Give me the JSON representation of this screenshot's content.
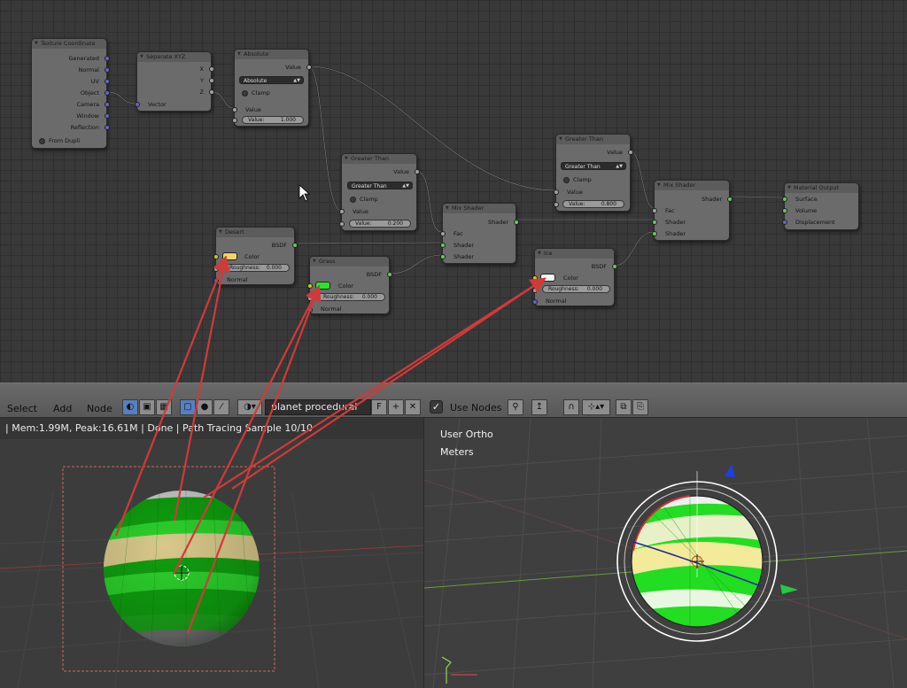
{
  "colors": {
    "socket_shader": "#63c763",
    "socket_vector": "#6363c7",
    "socket_value": "#a1a1a1",
    "socket_color": "#c7c729",
    "arrow": "#d03a3a",
    "desert_color": "#f0d56b",
    "grass_color": "#2ee02e",
    "ice_color": "#f5f5f5",
    "toggle_active": "#5680c2"
  },
  "nodes": {
    "texcoord": {
      "title": "Texture Coordinate",
      "outputs": [
        "Generated",
        "Normal",
        "UV",
        "Object",
        "Camera",
        "Window",
        "Reflection"
      ],
      "from_dupli": "From Dupli"
    },
    "separate": {
      "title": "Separate XYZ",
      "outputs": [
        "X",
        "Y",
        "Z"
      ],
      "input": "Vector"
    },
    "absolute": {
      "title": "Absolute",
      "output": "Value",
      "operation": "Absolute",
      "clamp": "Clamp",
      "input_value": "Value",
      "field_label": "Value:",
      "field_value": "1.000"
    },
    "greater1": {
      "title": "Greater Than",
      "output": "Value",
      "operation": "Greater Than",
      "clamp": "Clamp",
      "input_value": "Value",
      "field_label": "Value:",
      "field_value": "0.200"
    },
    "greater2": {
      "title": "Greater Than",
      "output": "Value",
      "operation": "Greater Than",
      "clamp": "Clamp",
      "input_value": "Value",
      "field_label": "Value:",
      "field_value": "0.800"
    },
    "mix1": {
      "title": "Mix Shader",
      "output": "Shader",
      "inputs": [
        "Fac",
        "Shader",
        "Shader"
      ]
    },
    "mix2": {
      "title": "Mix Shader",
      "output": "Shader",
      "inputs": [
        "Fac",
        "Shader",
        "Shader"
      ]
    },
    "output": {
      "title": "Material Output",
      "inputs": [
        "Surface",
        "Volume",
        "Displacement"
      ]
    },
    "desert": {
      "title": "Desert",
      "output": "BSDF",
      "color": "Color",
      "roughness_label": "Roughness:",
      "roughness": "0.000",
      "normal": "Normal"
    },
    "grass": {
      "title": "Grass",
      "output": "BSDF",
      "color": "Color",
      "roughness_label": "Roughness:",
      "roughness": "0.000",
      "normal": "Normal"
    },
    "ice": {
      "title": "Ice",
      "output": "BSDF",
      "color": "Color",
      "roughness_label": "Roughness:",
      "roughness": "0.000",
      "normal": "Normal"
    }
  },
  "header": {
    "menu": [
      "Select",
      "Add",
      "Node"
    ],
    "material_name": "planet procedural",
    "fake_user": "F",
    "use_nodes_label": "Use Nodes",
    "use_nodes_checked": true
  },
  "status": {
    "text": "| Mem:1.99M, Peak:16.61M | Done | Path Tracing Sample 10/10"
  },
  "viewport_right": {
    "view_label": "User Ortho",
    "units_label": "Meters"
  }
}
